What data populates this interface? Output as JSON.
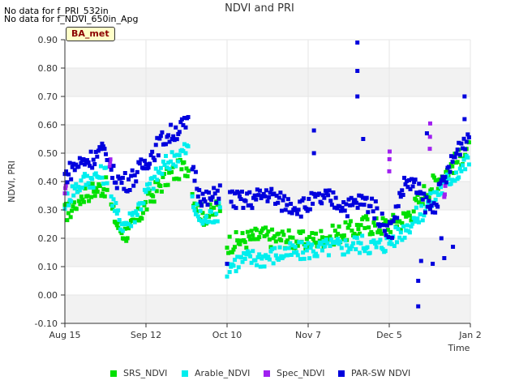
{
  "nodata_lines": [
    "No data for f_PRI_532in",
    "No data for f_NDVI_650in_Apg"
  ],
  "badge": "BA_met",
  "chart_data": {
    "type": "scatter",
    "title": "NDVI and PRI",
    "xlabel": "Time",
    "ylabel": "NDVI, PRI",
    "xlim": [
      0,
      140
    ],
    "ylim": [
      -0.1,
      0.9
    ],
    "yticks": [
      -0.1,
      0.0,
      0.1,
      0.2,
      0.3,
      0.4,
      0.5,
      0.6,
      0.7,
      0.8,
      0.9
    ],
    "ytick_labels": [
      "-0.10",
      "0.00",
      "0.10",
      "0.20",
      "0.30",
      "0.40",
      "0.50",
      "0.60",
      "0.70",
      "0.80",
      "0.90"
    ],
    "xticks": [
      {
        "day": 0,
        "label": "Aug 15"
      },
      {
        "day": 28,
        "label": "Sep 12"
      },
      {
        "day": 56,
        "label": "Oct 10"
      },
      {
        "day": 84,
        "label": "Nov 7"
      },
      {
        "day": 112,
        "label": "Dec 5"
      },
      {
        "day": 140,
        "label": "Jan 2"
      }
    ],
    "background_bands": true,
    "legend_position": "bottom",
    "series": [
      {
        "name": "SRS_NDVI",
        "color": "#00e000",
        "segments": [
          [
            0,
            0.29,
            2,
            0.3,
            4,
            0.33,
            7,
            0.36,
            10,
            0.37,
            13,
            0.38,
            15,
            0.38
          ],
          [
            16,
            0.31,
            18,
            0.25,
            20,
            0.22,
            22,
            0.22,
            24,
            0.25,
            27,
            0.3,
            30,
            0.35,
            33,
            0.39,
            36,
            0.42,
            39,
            0.44,
            42,
            0.45,
            43,
            0.46
          ],
          [
            44,
            0.36,
            46,
            0.3,
            48,
            0.28,
            51,
            0.29,
            54,
            0.32
          ],
          [
            56,
            0.18,
            60,
            0.19,
            64,
            0.2,
            68,
            0.21,
            72,
            0.2,
            76,
            0.2,
            80,
            0.19,
            84,
            0.19,
            88,
            0.2,
            92,
            0.21,
            96,
            0.22,
            100,
            0.23,
            104,
            0.25,
            108,
            0.24,
            112,
            0.25,
            116,
            0.26,
            120,
            0.3,
            124,
            0.36,
            128,
            0.4,
            132,
            0.44,
            136,
            0.48,
            140,
            0.52
          ]
        ]
      },
      {
        "name": "Arable_NDVI",
        "color": "#00eeee",
        "segments": [
          [
            0,
            0.33,
            3,
            0.37,
            6,
            0.4,
            9,
            0.41,
            12,
            0.42,
            15,
            0.43
          ],
          [
            16,
            0.35,
            18,
            0.28,
            20,
            0.25,
            22,
            0.26,
            25,
            0.3,
            28,
            0.36,
            31,
            0.41,
            34,
            0.45,
            37,
            0.48,
            40,
            0.5,
            43,
            0.52
          ],
          [
            44,
            0.33,
            46,
            0.28,
            48,
            0.26,
            51,
            0.28,
            54,
            0.3
          ],
          [
            56,
            0.1,
            60,
            0.12,
            64,
            0.13,
            68,
            0.13,
            72,
            0.14,
            76,
            0.15,
            80,
            0.15,
            84,
            0.16,
            88,
            0.16,
            92,
            0.17,
            96,
            0.17,
            100,
            0.18,
            104,
            0.18,
            108,
            0.17,
            112,
            0.19,
            116,
            0.22,
            120,
            0.26,
            124,
            0.3,
            128,
            0.35,
            132,
            0.4,
            136,
            0.44,
            140,
            0.48
          ]
        ]
      },
      {
        "name": "Spec_NDVI",
        "color": "#a020f0",
        "segments": [
          [
            0,
            0.36,
            0.5,
            0.4
          ],
          [
            15.5,
            0.45,
            15.8,
            0.5
          ],
          [
            112,
            0.44,
            112.2,
            0.54
          ],
          [
            126,
            0.52,
            126.2,
            0.64
          ],
          [
            131,
            0.34,
            131.5,
            0.4
          ]
        ]
      },
      {
        "name": "PAR-SW NDVI",
        "color": "#0000dd",
        "segments": [
          [
            0,
            0.42,
            3,
            0.45,
            6,
            0.47,
            9,
            0.48,
            12,
            0.5,
            15,
            0.51
          ],
          [
            16,
            0.43,
            18,
            0.41,
            20,
            0.4,
            22,
            0.4,
            25,
            0.43,
            28,
            0.47,
            31,
            0.51,
            34,
            0.55,
            37,
            0.57,
            40,
            0.59,
            43,
            0.6
          ],
          [
            44,
            0.46,
            46,
            0.38,
            48,
            0.33,
            51,
            0.34,
            54,
            0.38
          ],
          [
            57,
            0.34,
            62,
            0.33,
            66,
            0.34,
            70,
            0.36,
            74,
            0.33,
            78,
            0.32,
            82,
            0.31,
            86,
            0.33,
            90,
            0.34,
            94,
            0.33,
            98,
            0.31,
            102,
            0.33,
            106,
            0.32,
            110,
            0.25,
            113,
            0.23,
            116,
            0.36,
            118,
            0.4,
            121,
            0.38,
            124,
            0.33,
            127,
            0.3,
            130,
            0.38,
            133,
            0.45,
            136,
            0.52,
            140,
            0.57
          ]
        ],
        "outliers": [
          [
            101,
            0.89
          ],
          [
            101,
            0.79
          ],
          [
            101,
            0.7
          ],
          [
            86,
            0.58
          ],
          [
            86,
            0.5
          ],
          [
            103,
            0.55
          ],
          [
            122,
            0.05
          ],
          [
            122,
            -0.04
          ],
          [
            123,
            0.12
          ],
          [
            138,
            0.7
          ],
          [
            138,
            0.62
          ],
          [
            127,
            0.11
          ],
          [
            131,
            0.13
          ],
          [
            130,
            0.2
          ],
          [
            56,
            0.11
          ],
          [
            125,
            0.57
          ],
          [
            134,
            0.17
          ]
        ]
      }
    ]
  }
}
